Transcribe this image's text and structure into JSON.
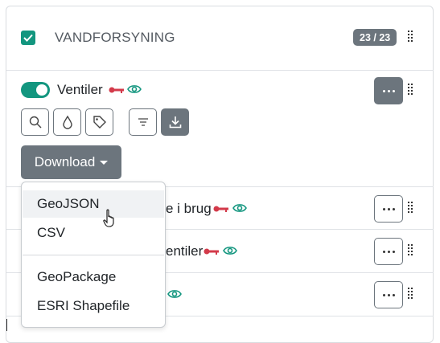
{
  "group": {
    "title": "VANDFORSYNING",
    "checked": true,
    "count": "23 / 23"
  },
  "active_layer": {
    "name": "Ventiler",
    "enabled": true,
    "key_icon": "key-icon",
    "eye_icon": "eye-icon"
  },
  "tools": [
    {
      "name": "search-icon"
    },
    {
      "name": "drop-icon"
    },
    {
      "name": "tag-icon"
    },
    {
      "name": "filter-icon"
    },
    {
      "name": "download-icon"
    }
  ],
  "download": {
    "label": "Download",
    "menu": [
      "GeoJSON",
      "CSV",
      "GeoPackage",
      "ESRI Shapefile"
    ],
    "hovered": "GeoJSON"
  },
  "layers": [
    {
      "name_visible": "e i brug",
      "has_key": true
    },
    {
      "name_visible": "entiler",
      "has_key": true
    },
    {
      "name_visible": "",
      "has_key": false
    }
  ],
  "colors": {
    "accent": "#13967f",
    "button_gray": "#6c757d",
    "key": "#d33a4a"
  }
}
